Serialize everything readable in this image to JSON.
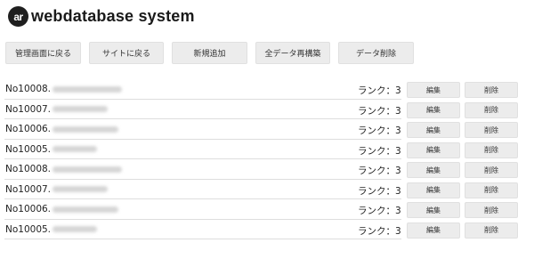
{
  "header": {
    "logo_text": "ar",
    "title": "webdatabase system"
  },
  "toolbar": {
    "buttons": [
      {
        "label": "管理画面に戻る"
      },
      {
        "label": "サイトに戻る"
      },
      {
        "label": "新規追加"
      },
      {
        "label": "全データ再構築"
      },
      {
        "label": "データ削除"
      }
    ]
  },
  "records": [
    {
      "id": "No10008.",
      "rank": "ランク：3",
      "edit_label": "編集",
      "delete_label": "削除"
    },
    {
      "id": "No10007.",
      "rank": "ランク：3",
      "edit_label": "編集",
      "delete_label": "削除"
    },
    {
      "id": "No10006.",
      "rank": "ランク：3",
      "edit_label": "編集",
      "delete_label": "削除"
    },
    {
      "id": "No10005.",
      "rank": "ランク：3",
      "edit_label": "編集",
      "delete_label": "削除"
    },
    {
      "id": "No10008.",
      "rank": "ランク：3",
      "edit_label": "編集",
      "delete_label": "削除"
    },
    {
      "id": "No10007.",
      "rank": "ランク：3",
      "edit_label": "編集",
      "delete_label": "削除"
    },
    {
      "id": "No10006.",
      "rank": "ランク：3",
      "edit_label": "編集",
      "delete_label": "削除"
    },
    {
      "id": "No10005.",
      "rank": "ランク：3",
      "edit_label": "編集",
      "delete_label": "削除"
    }
  ]
}
